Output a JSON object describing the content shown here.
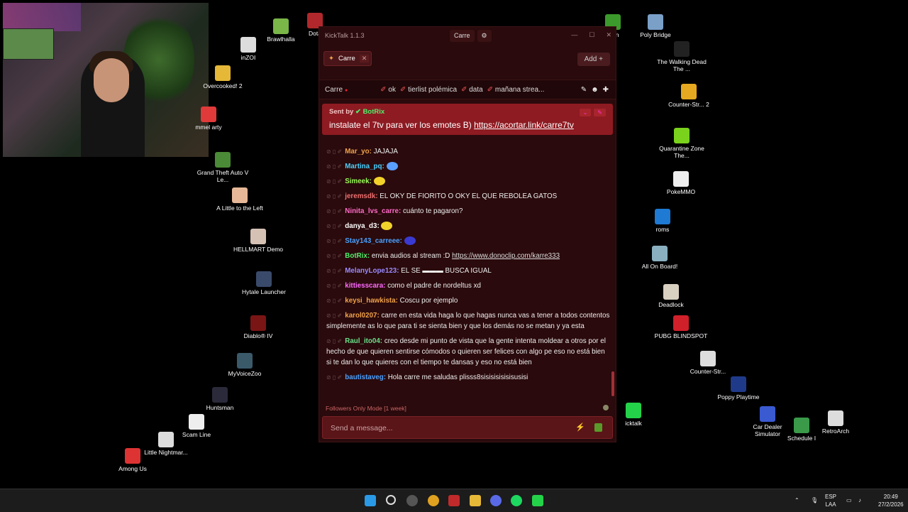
{
  "desktop_icons": [
    {
      "label": "Brawlhalla",
      "color": "#7ab648"
    },
    {
      "label": "Dota",
      "color": "#b0282b"
    },
    {
      "label": "inZOI",
      "color": "#ddd"
    },
    {
      "label": "Overcooked! 2",
      "color": "#e6b838"
    },
    {
      "label": "mmel arty",
      "color": "#e03a3a"
    },
    {
      "label": "Grand Theft Auto V Le...",
      "color": "#4b8a36"
    },
    {
      "label": "A Little to the Left",
      "color": "#e6b898"
    },
    {
      "label": "HELLMART Demo",
      "color": "#d5c2b4"
    },
    {
      "label": "Hytale Launcher",
      "color": "#3a4a6a"
    },
    {
      "label": "Diablo® IV",
      "color": "#7a1515"
    },
    {
      "label": "MyVoiceZoo",
      "color": "#3a5a6a"
    },
    {
      "label": "Huntsman",
      "color": "#2a2a3a"
    },
    {
      "label": "Scam Line",
      "color": "#eeeeee"
    },
    {
      "label": "Little Nightmar...",
      "color": "#dddddd"
    },
    {
      "label": "Among Us",
      "color": "#d33"
    },
    {
      "label": "drun",
      "color": "#3c9a2c"
    },
    {
      "label": "Poly Bridge",
      "color": "#7aa0c8"
    },
    {
      "label": "The Walking Dead The ...",
      "color": "#222"
    },
    {
      "label": "Counter-Str... 2",
      "color": "#e6a820"
    },
    {
      "label": "Quarantine Zone The...",
      "color": "#7ad21c"
    },
    {
      "label": "PokeMMO",
      "color": "#eeeeee"
    },
    {
      "label": "roms",
      "color": "#1e7ad2"
    },
    {
      "label": "All On Board!",
      "color": "#8ab0c0"
    },
    {
      "label": "Deadlock",
      "color": "#d8d0c0"
    },
    {
      "label": "PUBG BLINDSPOT",
      "color": "#d0202a"
    },
    {
      "label": "Counter-Str...",
      "color": "#dddddd"
    },
    {
      "label": "Poppy Playtime",
      "color": "#203a8a"
    },
    {
      "label": "icktalk",
      "color": "#24d24a"
    },
    {
      "label": "Car Dealer Simulator",
      "color": "#3a5ad2"
    },
    {
      "label": "Schedule I",
      "color": "#3a9a4a"
    },
    {
      "label": "RetroArch",
      "color": "#dddddd"
    }
  ],
  "app": {
    "title": "KickTalk 1.1.3",
    "channel_chip": "Carre",
    "tab_label": "Carre",
    "add_label": "Add  +",
    "channel_name": "Carre",
    "pinned_tags": [
      "ok",
      "tierlist polémica",
      "data",
      "mañana strea..."
    ],
    "pinned": {
      "sent_by": "Sent by",
      "sender": "BotRix",
      "text": "instalate el 7tv para ver los emotes B) ",
      "link": "https://acortar.link/carre7tv"
    },
    "messages": [
      {
        "user": "Mar_yo:",
        "color": "#f0a24a",
        "text": "JAJAJA"
      },
      {
        "user": "Martina_pq:",
        "color": "#4ad2ff",
        "text": "",
        "emote": "#5aa0ff"
      },
      {
        "user": "Simeek:",
        "color": "#9aff5a",
        "text": "",
        "emote": "#f2d22a"
      },
      {
        "user": "jeremsdk:",
        "color": "#f07070",
        "text": "EL OKY DE FIORITO O OKY EL QUE REBOLEA GATOS"
      },
      {
        "user": "Ninita_lvs_carre:",
        "color": "#ff6ac8",
        "text": "cuánto te pagaron?"
      },
      {
        "user": "danya_d3:",
        "color": "#ffffff",
        "text": "",
        "emote": "#f2d22a"
      },
      {
        "user": "Stay143_carreee:",
        "color": "#4aa0ff",
        "text": "",
        "emote": "#3a3ad2"
      },
      {
        "user": "BotRix:",
        "color": "#4ff06b",
        "text": "envia audios al stream :D ",
        "link": "https://www.donoclip.com/karre333"
      },
      {
        "user": "MelanyLope123:",
        "color": "#9a8aff",
        "text": "EL SE ▬▬▬ BUSCA IGUAL"
      },
      {
        "user": "kittiesscara:",
        "color": "#ff6aff",
        "text": "como el padre de nordeltus xd"
      },
      {
        "user": "keysi_hawkista:",
        "color": "#f0a24a",
        "text": "Coscu por ejemplo"
      },
      {
        "user": "karol0207:",
        "color": "#f0a24a",
        "text": "carre en esta vida haga lo que hagas nunca vas a tener a todos contentos simplemente as lo que para ti se sienta bien y que los demás no se metan y ya esta"
      },
      {
        "user": "Raul_ito04:",
        "color": "#6ae08a",
        "text": "creo desde mi punto de vista que la gente intenta moldear a otros por el hecho de que quieren sentirse cómodos o quieren ser felices con algo pe eso no está bien si te dan lo que quieres con el tiempo te dansas y eso no está bien"
      },
      {
        "user": "bautistaveg:",
        "color": "#4aa0ff",
        "text": "Hola carre me saludas plisss8sisisisisisisusisi"
      }
    ],
    "followers_mode": "Followers Only Mode [1 week]",
    "input_placeholder": "Send a message..."
  },
  "taskbar": {
    "lang": "ESP",
    "layout": "LAA",
    "time": "20:49",
    "date": "27/2/2026"
  }
}
